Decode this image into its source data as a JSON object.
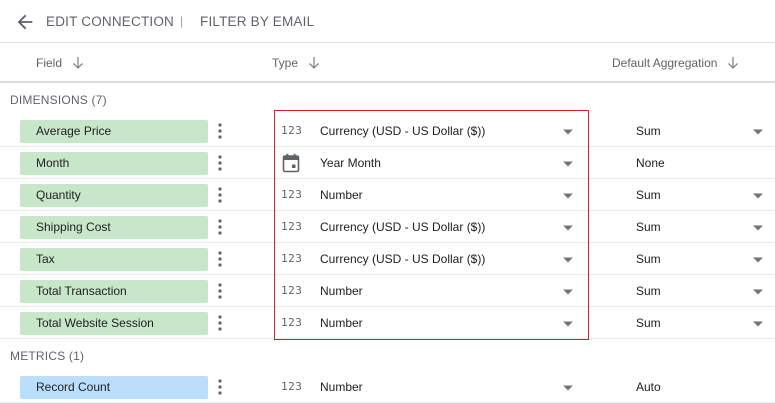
{
  "toolbar": {
    "edit_connection": "EDIT CONNECTION",
    "separator": "|",
    "filter_by_email": "FILTER BY EMAIL"
  },
  "columns": {
    "field": "Field",
    "type": "Type",
    "aggregation": "Default Aggregation"
  },
  "dimensions": {
    "heading": "DIMENSIONS (7)",
    "rows": [
      {
        "name": "Average Price",
        "type_icon": "123",
        "type": "Currency (USD - US Dollar ($))",
        "agg": "Sum",
        "agg_dropdown": true
      },
      {
        "name": "Month",
        "type_icon": "calendar",
        "type": "Year Month",
        "agg": "None",
        "agg_dropdown": false
      },
      {
        "name": "Quantity",
        "type_icon": "123",
        "type": "Number",
        "agg": "Sum",
        "agg_dropdown": true
      },
      {
        "name": "Shipping Cost",
        "type_icon": "123",
        "type": "Currency (USD - US Dollar ($))",
        "agg": "Sum",
        "agg_dropdown": true
      },
      {
        "name": "Tax",
        "type_icon": "123",
        "type": "Currency (USD - US Dollar ($))",
        "agg": "Sum",
        "agg_dropdown": true
      },
      {
        "name": "Total Transaction",
        "type_icon": "123",
        "type": "Number",
        "agg": "Sum",
        "agg_dropdown": true
      },
      {
        "name": "Total Website Session",
        "type_icon": "123",
        "type": "Number",
        "agg": "Sum",
        "agg_dropdown": true
      }
    ]
  },
  "metrics": {
    "heading": "METRICS (1)",
    "rows": [
      {
        "name": "Record Count",
        "type_icon": "123",
        "type": "Number",
        "agg": "Auto",
        "agg_dropdown": false
      }
    ]
  },
  "icons": {
    "back": "arrow-back-icon",
    "sort": "arrow-down-icon",
    "more": "more-vert-icon",
    "dropdown": "caret-down-icon",
    "calendar": "calendar-icon"
  },
  "colors": {
    "dimension_chip": "#c8e6c9",
    "metric_chip": "#bbdefb",
    "highlight_border": "#c62828"
  }
}
